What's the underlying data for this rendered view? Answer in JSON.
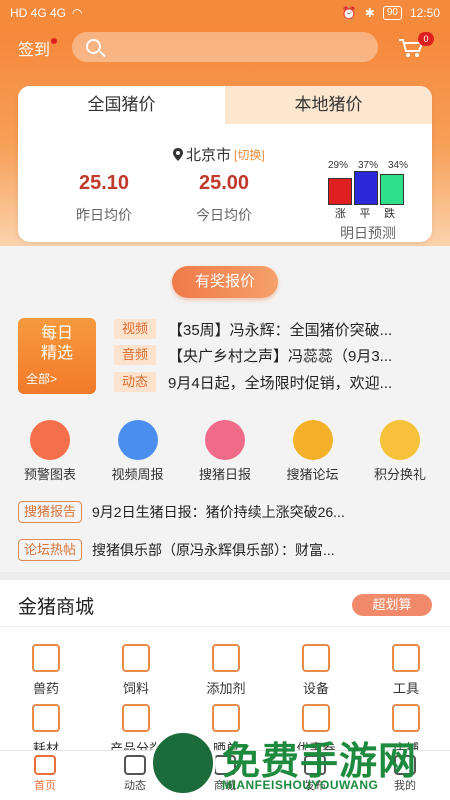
{
  "status_bar": {
    "left": "HD 4G 4G",
    "battery": "90",
    "time": "12:50"
  },
  "header": {
    "checkin_label": "签到",
    "cart_badge": "0"
  },
  "price_card": {
    "tabs": [
      "全国猪价",
      "本地猪价"
    ],
    "city": "北京市",
    "switch_label": "[切换]",
    "yesterday": {
      "value": "25.10",
      "label": "昨日均价"
    },
    "today": {
      "value": "25.00",
      "label": "今日均价"
    },
    "forecast": {
      "title": "明日预测",
      "items": [
        {
          "pct": "29%",
          "name": "涨",
          "color": "#e02020",
          "value": 29
        },
        {
          "pct": "37%",
          "name": "平",
          "color": "#2a2ad8",
          "value": 37
        },
        {
          "pct": "34%",
          "name": "跌",
          "color": "#2fe08a",
          "value": 34
        }
      ]
    }
  },
  "reward_button": "有奖报价",
  "daily_picks": {
    "title_line1": "每日",
    "title_line2": "精选",
    "all": "全部>",
    "items": [
      {
        "tag": "视频",
        "text": "【35周】冯永辉：全国猪价突破..."
      },
      {
        "tag": "音频",
        "text": "【央广乡村之声】冯蕊蕊（9月3..."
      },
      {
        "tag": "动态",
        "text": "9月4日起，全场限时促销，欢迎..."
      }
    ]
  },
  "menu": [
    {
      "label": "预警图表",
      "icon": "chart-icon",
      "color": "#f5704a"
    },
    {
      "label": "视频周报",
      "icon": "tv-icon",
      "color": "#4a8ef0"
    },
    {
      "label": "搜猪日报",
      "icon": "calendar-icon",
      "color": "#f06a8a"
    },
    {
      "label": "搜猪论坛",
      "icon": "people-icon",
      "color": "#f5b02a"
    },
    {
      "label": "积分换礼",
      "icon": "gift-icon",
      "color": "#f7c23a"
    }
  ],
  "news": [
    {
      "tag": "搜猪报告",
      "text": "9月2日生猪日报：猪价持续上涨突破26..."
    },
    {
      "tag": "论坛热帖",
      "text": "搜猪俱乐部（原冯永辉俱乐部）：财富..."
    }
  ],
  "mall": {
    "title": "金猪商城",
    "badge": "超划算",
    "categories": [
      {
        "label": "兽药",
        "icon": "medicine-icon"
      },
      {
        "label": "饲料",
        "icon": "feed-icon"
      },
      {
        "label": "添加剂",
        "icon": "bottle-icon"
      },
      {
        "label": "设备",
        "icon": "equipment-icon"
      },
      {
        "label": "工具",
        "icon": "tools-icon"
      },
      {
        "label": "耗材",
        "icon": "syringe-icon"
      },
      {
        "label": "产品分类",
        "icon": "grid-icon"
      },
      {
        "label": "晒单",
        "icon": "heart-icon"
      },
      {
        "label": "优惠券",
        "icon": "coupon-icon"
      },
      {
        "label": "店铺",
        "icon": "shop-icon"
      }
    ]
  },
  "tabbar": [
    {
      "label": "首页",
      "icon": "home-icon",
      "active": true
    },
    {
      "label": "动态",
      "icon": "video-icon",
      "active": false
    },
    {
      "label": "商城",
      "icon": "store-icon",
      "active": false
    },
    {
      "label": "发布",
      "icon": "publish-icon",
      "active": false
    },
    {
      "label": "我的",
      "icon": "profile-icon",
      "active": false
    }
  ],
  "watermark": {
    "big": "免费手游网",
    "small": "MIANFEISHOUYOUWANG"
  }
}
